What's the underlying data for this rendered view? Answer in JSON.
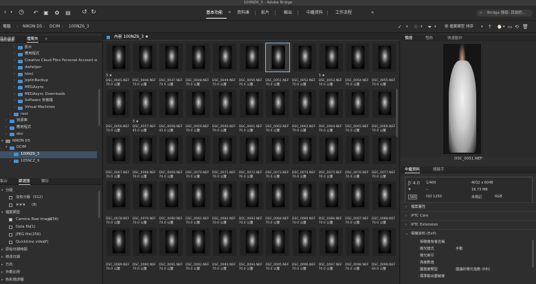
{
  "window": {
    "title": "100NZ6_3 - Adobe Bridge"
  },
  "toolbar": {
    "workspaces": [
      "基本功能",
      "資料庫",
      "影片",
      "輸出",
      "中繼資料",
      "工作流程"
    ],
    "active_workspace": "基本功能",
    "more": "»",
    "search_placeholder": "Bridge 搜尋: 目前的..."
  },
  "breadcrumb": [
    "電腦",
    "NIKON D5",
    "DCIM",
    "100NZ6_3"
  ],
  "sort": {
    "label": "依 檔案類型 排序"
  },
  "left_tabs": {
    "tab1": "我的最愛",
    "tab2": "檔案夾"
  },
  "folders": [
    {
      "label": "我的最愛",
      "indent": 0,
      "kind": "hidden"
    },
    {
      "label": "影片",
      "indent": 3,
      "kind": "folder"
    },
    {
      "label": "應用程式",
      "indent": 3,
      "kind": "folder"
    },
    {
      "label": "Creative Cloud Files Personal Account smart",
      "indent": 3,
      "kind": "folder"
    },
    {
      "label": "dwhelper",
      "indent": 3,
      "kind": "folder"
    },
    {
      "label": "html",
      "indent": 3,
      "kind": "folder"
    },
    {
      "label": "JoplinBackup",
      "indent": 3,
      "kind": "folder"
    },
    {
      "label": "MEGAsync",
      "indent": 3,
      "kind": "folder"
    },
    {
      "label": "MEGAsync Downloads",
      "indent": 3,
      "kind": "folder"
    },
    {
      "label": "Software 安裝檔",
      "indent": 3,
      "kind": "folder"
    },
    {
      "label": "Virtual Machines",
      "indent": 3,
      "kind": "folder"
    },
    {
      "label": "root",
      "indent": 2,
      "kind": "folder"
    },
    {
      "label": "資源庫",
      "indent": 1,
      "kind": "folder"
    },
    {
      "label": "應用程式",
      "indent": 1,
      "kind": "folder"
    },
    {
      "label": "dev",
      "indent": 1,
      "kind": "folder"
    },
    {
      "label": "NIKON D5",
      "indent": 0,
      "kind": "drive"
    },
    {
      "label": "DCIM",
      "indent": 1,
      "kind": "folder"
    },
    {
      "label": "100NZ6_3",
      "indent": 2,
      "kind": "folder",
      "selected": true
    },
    {
      "label": "105NCZ_9",
      "indent": 2,
      "kind": "folder"
    }
  ],
  "filter_tabs": {
    "tab0": "集合",
    "tab1": "篩選器",
    "tab2": "轉存"
  },
  "filter": {
    "sec_rating": "分級",
    "r1": "沒有分級",
    "r1c": "(512)",
    "r2": "★★★",
    "r2c": "(8)",
    "sec_type": "檔案類型",
    "t1": "Camera Raw image",
    "t1c": "(256)",
    "t2": "Data file",
    "t2c": "(1)",
    "t3": "JPEG file",
    "t3c": "(256)",
    "t4": "Quicktime video",
    "t4c": "(7)",
    "s1": "原始日期時間",
    "s2": "修改日期",
    "s3": "方向",
    "s4": "外觀比例",
    "s5": "色彩描述檔"
  },
  "content": {
    "title": "內容",
    "path": "100NZ6_3",
    "star": "★"
  },
  "thumbs": [
    {
      "name": "DSC_0045.NEF",
      "size": "70.0 公釐",
      "stars": "3 ★"
    },
    {
      "name": "DSC_0046.NEF",
      "size": "70.0 公釐"
    },
    {
      "name": "DSC_0047.NEF",
      "size": "70.0 公釐"
    },
    {
      "name": "DSC_0048.NEF",
      "size": "70.0 公釐"
    },
    {
      "name": "DSC_0049.NEF",
      "size": "70.0 公釐"
    },
    {
      "name": "DSC_0050.NEF",
      "size": "70.0 公釐"
    },
    {
      "name": "DSC_0051.NEF",
      "size": "70.0 公釐",
      "selected": true
    },
    {
      "name": "DSC_0052.NEF",
      "size": "70.0 公釐"
    },
    {
      "name": "DSC_0053.NEF",
      "size": "70.0 公釐",
      "stars": "3 ★"
    },
    {
      "name": "DSC_0054.NEF",
      "size": "70.0 公釐"
    },
    {
      "name": "DSC_0055.NEF",
      "size": "70.0 公釐"
    },
    {
      "name": "DSC_0056.NEF",
      "size": "70.0 公釐"
    },
    {
      "name": "DSC_0057.NEF",
      "size": "45.0 公釐",
      "stars": "3 ★"
    },
    {
      "name": "DSC_0058.NEF",
      "size": "45.0 公釐"
    },
    {
      "name": "DSC_0059.NEF",
      "size": "70.0 公釐"
    },
    {
      "name": "DSC_0060.NEF",
      "size": "70.0 公釐"
    },
    {
      "name": "DSC_0061.NEF",
      "size": "70.0 公釐"
    },
    {
      "name": "DSC_0062.NEF",
      "size": "70.0 公釐"
    },
    {
      "name": "DSC_0063.NEF",
      "size": "70.0 公釐"
    },
    {
      "name": "DSC_0064.NEF",
      "size": "70.0 公釐"
    },
    {
      "name": "DSC_0065.NEF",
      "size": "70.0 公釐"
    },
    {
      "name": "DSC_0066.NEF",
      "size": "70.0 公釐"
    },
    {
      "name": "DSC_0067.NEF",
      "size": "70.0 公釐"
    },
    {
      "name": "DSC_0068.NEF",
      "size": "70.0 公釐"
    },
    {
      "name": "DSC_0069.NEF",
      "size": "70.0 公釐"
    },
    {
      "name": "DSC_0070.NEF",
      "size": "70.0 公釐"
    },
    {
      "name": "DSC_0071.NEF",
      "size": "70.0 公釐"
    },
    {
      "name": "DSC_0072.NEF",
      "size": "70.0 公釐"
    },
    {
      "name": "DSC_0073.NEF",
      "size": "70.0 公釐"
    },
    {
      "name": "DSC_0074.NEF",
      "size": "70.0 公釐"
    },
    {
      "name": "DSC_0075.NEF",
      "size": "70.0 公釐"
    },
    {
      "name": "DSC_0076.NEF",
      "size": "70.0 公釐"
    },
    {
      "name": "DSC_0077.NEF",
      "size": "70.0 公釐"
    },
    {
      "name": "DSC_0078.NEF",
      "size": "70.0 公釐"
    },
    {
      "name": "DSC_0079.NEF",
      "size": "70.0 公釐"
    },
    {
      "name": "DSC_0080.NEF",
      "size": "70.0 公釐"
    },
    {
      "name": "DSC_0081.NEF",
      "size": "70.0 公釐"
    },
    {
      "name": "DSC_0082.NEF",
      "size": "70.0 公釐"
    },
    {
      "name": "DSC_0083.NEF",
      "size": "70.0 公釐"
    },
    {
      "name": "DSC_0084.NEF",
      "size": "70.0 公釐"
    },
    {
      "name": "DSC_0085.NEF",
      "size": "70.0 公釐"
    },
    {
      "name": "DSC_0086.NEF",
      "size": "70.0 公釐"
    },
    {
      "name": "DSC_0087.NEF",
      "size": "70.0 公釐"
    },
    {
      "name": "DSC_0088.NEF",
      "size": "70.0 公釐"
    },
    {
      "name": "DSC_0089.NEF",
      "size": "70.0 公釐"
    },
    {
      "name": "DSC_0090.NEF",
      "size": "70.0 公釐"
    },
    {
      "name": "DSC_0091.NEF",
      "size": "70.0 公釐"
    },
    {
      "name": "DSC_0092.NEF",
      "size": "70.0 公釐"
    },
    {
      "name": "DSC_0093.NEF",
      "size": "70.0 公釐"
    },
    {
      "name": "DSC_0094.NEF",
      "size": "70.0 公釐"
    },
    {
      "name": "DSC_0095.NEF",
      "size": "70.0 公釐"
    },
    {
      "name": "DSC_0096.NEF",
      "size": "70.0 公釐"
    },
    {
      "name": "DSC_0097.NEF",
      "size": "70.0 公釐"
    },
    {
      "name": "DSC_0098.NEF",
      "size": "70.0 公釐"
    },
    {
      "name": "DSC_0099.NEF",
      "size": "60.0 公釐"
    }
  ],
  "right_tabs": {
    "tab1": "預視",
    "tab2": "發佈",
    "tab3": "快速動作"
  },
  "preview": {
    "caption": "DSC_0051.NEF"
  },
  "meta_tabs": {
    "tab1": "中繼資料",
    "tab2": "關鍵字"
  },
  "meta": {
    "aperture": "ƒ/ 4.0",
    "shutter": "1/400",
    "exposure_comp": "--",
    "iso": "ISO 1250",
    "dimensions": "4032 x 6048",
    "filesize": "16.73 MB",
    "profile": "未標記",
    "mode": "RGB"
  },
  "meta_sections": [
    "檔案屬性",
    "IPTC Core",
    "IPTC Extension",
    "相機資料 (Exif)"
  ],
  "exif": [
    {
      "k": "相機擁有者名稱",
      "v": ""
    },
    {
      "k": "曝光模式",
      "v": "手動"
    },
    {
      "k": "曝光索引",
      "v": ""
    },
    {
      "k": "亮度數值",
      "v": ""
    },
    {
      "k": "圖樣度類型",
      "v": "建議的曝光指數 (REI)"
    },
    {
      "k": "標準輸出靈敏度",
      "v": ""
    }
  ]
}
